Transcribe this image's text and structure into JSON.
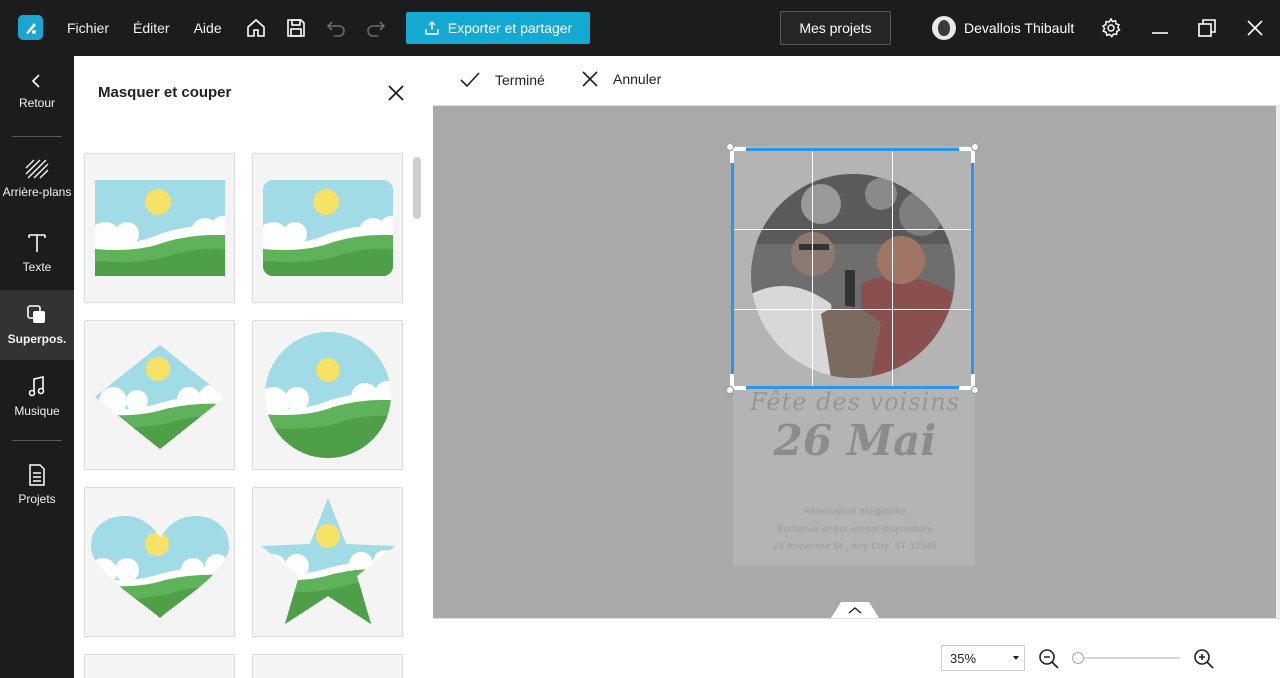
{
  "topbar": {
    "menu": [
      "Fichier",
      "Éditer",
      "Aide"
    ],
    "export_label": "Exporter et partager",
    "projects_label": "Mes projets",
    "user_name": "Devallois Thibault"
  },
  "rail": {
    "items": [
      {
        "label": "Retour",
        "icon": "chevron-left-icon"
      },
      {
        "label": "Arrière-plans",
        "icon": "hatch-background-icon"
      },
      {
        "label": "Texte",
        "icon": "text-icon"
      },
      {
        "label": "Superpos.",
        "icon": "overlay-icon",
        "active": true
      },
      {
        "label": "Musique",
        "icon": "music-note-icon"
      },
      {
        "label": "Projets",
        "icon": "document-icon"
      }
    ]
  },
  "panel": {
    "title": "Masquer et couper",
    "shapes": [
      "rectangle",
      "rounded-rectangle",
      "diamond",
      "circle",
      "heart",
      "star"
    ]
  },
  "toolbar": {
    "done_label": "Terminé",
    "cancel_label": "Annuler"
  },
  "flyer": {
    "script_title": "Fête des voisins",
    "date": "26 Mai",
    "line1": "Réservation obligatoire",
    "line2": "Barbecue et bar seront disponibles",
    "line3": "23 Anywhere St., Any City, ST 12345"
  },
  "zoom": {
    "value": "35%",
    "slider_fraction": 0.02
  },
  "colors": {
    "accent": "#13a9d3",
    "crop_frame": "#2b95e9",
    "topbar": "#1c1c1c",
    "canvas": "#a9a9a9"
  }
}
